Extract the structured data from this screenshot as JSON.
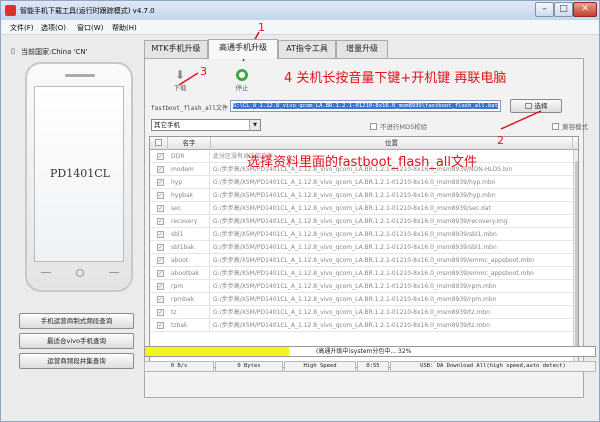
{
  "window": {
    "title": "智能手机下载工具(运行时跟踪模式) v4.7.0",
    "min_glyph": "–",
    "max_glyph": "□",
    "close_glyph": "✕"
  },
  "menu": [
    "文件(F)",
    "选项(O)",
    "窗口(W)",
    "帮助(H)"
  ],
  "left": {
    "country": "当前国家:China 'CN'",
    "phone_model": "PD1401CL",
    "buttons": [
      "手机运营商制式频段查询",
      "最适合vivo手机查询",
      "运营商频段并集查询"
    ]
  },
  "tabs": [
    "MTK手机升级",
    "高通手机升级",
    "AT指令工具",
    "增量升级"
  ],
  "active_tab": 1,
  "toolbar": {
    "download_label": "下载",
    "stop_label": "停止"
  },
  "fastboot": {
    "label": "fastboot_flash_all文件",
    "path": "G:\\CL_A_1.12.8_vivo_qcom_LA.BR.1.2.1-01210-8x16.0_msm8939\\fastboot_flash_all.bat",
    "select_button": "选择"
  },
  "phone_type": {
    "value": "其它手机",
    "arrow": "▼"
  },
  "options": {
    "no_md5": "不进行MD5校验",
    "compat_mode": "兼容模式"
  },
  "table": {
    "columns": [
      "",
      "名字",
      "位置"
    ],
    "rows": [
      {
        "name": "DDR",
        "path": "此分区没有对应的文件"
      },
      {
        "name": "modem",
        "path": "G:/步步高/X5M/PD1401CL_A_1.12.8_vivo_qcom_LA.BR.1.2.1-01210-8x16.0_msm8939/NON-HLOS.bin"
      },
      {
        "name": "hyp",
        "path": "G:/步步高/X5M/PD1401CL_A_1.12.8_vivo_qcom_LA.BR.1.2.1-01210-8x16.0_msm8939/hyp.mbn"
      },
      {
        "name": "hypbak",
        "path": "G:/步步高/X5M/PD1401CL_A_1.12.8_vivo_qcom_LA.BR.1.2.1-01210-8x16.0_msm8939/hyp.mbn"
      },
      {
        "name": "sec",
        "path": "G:/步步高/X5M/PD1401CL_A_1.12.8_vivo_qcom_LA.BR.1.2.1-01210-8x16.0_msm8939/sec.dat"
      },
      {
        "name": "recovery",
        "path": "G:/步步高/X5M/PD1401CL_A_1.12.8_vivo_qcom_LA.BR.1.2.1-01210-8x16.0_msm8939/recovery.img"
      },
      {
        "name": "sbl1",
        "path": "G:/步步高/X5M/PD1401CL_A_1.12.8_vivo_qcom_LA.BR.1.2.1-01210-8x16.0_msm8939/sbl1.mbn"
      },
      {
        "name": "sbl1bak",
        "path": "G:/步步高/X5M/PD1401CL_A_1.12.8_vivo_qcom_LA.BR.1.2.1-01210-8x16.0_msm8939/sbl1.mbn"
      },
      {
        "name": "aboot",
        "path": "G:/步步高/X5M/PD1401CL_A_1.12.8_vivo_qcom_LA.BR.1.2.1-01210-8x16.0_msm8939/emmc_appsboot.mbn"
      },
      {
        "name": "abootbak",
        "path": "G:/步步高/X5M/PD1401CL_A_1.12.8_vivo_qcom_LA.BR.1.2.1-01210-8x16.0_msm8939/emmc_appsboot.mbn"
      },
      {
        "name": "rpm",
        "path": "G:/步步高/X5M/PD1401CL_A_1.12.8_vivo_qcom_LA.BR.1.2.1-01210-8x16.0_msm8939/rpm.mbn"
      },
      {
        "name": "rpmbak",
        "path": "G:/步步高/X5M/PD1401CL_A_1.12.8_vivo_qcom_LA.BR.1.2.1-01210-8x16.0_msm8939/rpm.mbn"
      },
      {
        "name": "tz",
        "path": "G:/步步高/X5M/PD1401CL_A_1.12.8_vivo_qcom_LA.BR.1.2.1-01210-8x16.0_msm8939/tz.mbn"
      },
      {
        "name": "tzbak",
        "path": "G:/步步高/X5M/PD1401CL_A_1.12.8_vivo_qcom_LA.BR.1.2.1-01210-8x16.0_msm8939/tz.mbn"
      }
    ]
  },
  "progress": {
    "text": "(高通升级中)system分包中... 32%",
    "fraction": 0.32
  },
  "status": [
    "0 B/s",
    "0 Bytes",
    "High Speed",
    "0:55",
    "USB: DA Download All(high speed,auto detect)"
  ],
  "annotations": {
    "mark_1": "1",
    "mark_2": "2",
    "mark_3": "3",
    "note_power": "4 关机长按音量下键+开机键 再联电脑",
    "note_select": "选择资料里面的fastboot_flash_all文件"
  },
  "colors": {
    "annotation": "#e0121c",
    "progress_fill": "#f4f41e",
    "selection": "#3875d7"
  }
}
